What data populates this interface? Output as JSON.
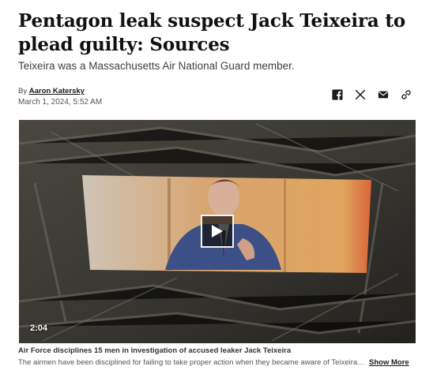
{
  "article": {
    "headline": "Pentagon leak suspect Jack Teixeira to plead guilty: Sources",
    "subhead": "Teixeira was a Massachusetts Air National Guard member.",
    "by_prefix": "By",
    "author": "Aaron Katersky",
    "date": "March 1, 2024, 5:52 AM"
  },
  "share_icons": [
    "facebook-icon",
    "x-icon",
    "email-icon",
    "link-icon"
  ],
  "video": {
    "duration": "2:04",
    "title": "Air Force disciplines 15 men in investigation of accused leaker Jack Teixeira",
    "description": "The airmen have been disciplined for failing to take proper action when they became aware of Teixeira's...",
    "show_more": "Show More"
  }
}
